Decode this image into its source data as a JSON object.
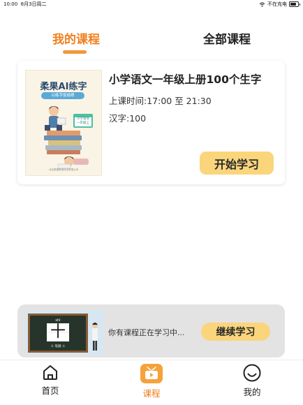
{
  "status_bar": {
    "time": "10:00",
    "date": "8月3日周二",
    "charging": "不在充电"
  },
  "tabs": [
    {
      "label": "我的课程",
      "active": true
    },
    {
      "label": "全部课程",
      "active": false
    }
  ],
  "colors": {
    "accent": "#f07f1e",
    "button": "#fbd57c"
  },
  "course": {
    "cover": {
      "title": "柔果AI练字",
      "subtitle": "以练字促成绩",
      "badge_line1": "小学语文",
      "badge_line2": "一年级上",
      "footer": "北京柔果教育科技有限公司"
    },
    "name": "小学语文一年级上册100个生字",
    "time": "上课时间:17:00 至 21:30",
    "count": "汉字:100",
    "start_label": "开始学习"
  },
  "resume": {
    "thumb_pinyin": "shí",
    "thumb_char": "十",
    "thumb_caption": "十 笔顺 十",
    "text": "你有课程正在学习中...",
    "continue_label": "继续学习"
  },
  "nav": [
    {
      "label": "首页",
      "icon": "home-icon",
      "active": false
    },
    {
      "label": "课程",
      "icon": "tv-icon",
      "active": true
    },
    {
      "label": "我的",
      "icon": "smiley-icon",
      "active": false
    }
  ]
}
